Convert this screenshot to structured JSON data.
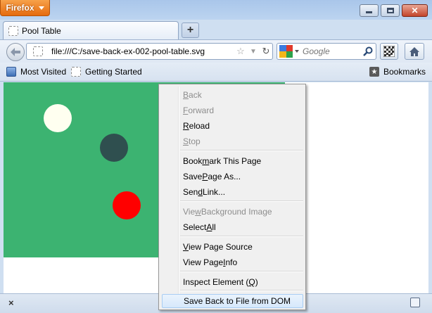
{
  "window": {
    "firefox_button": "Firefox",
    "tab_title": "Pool Table",
    "new_tab_label": "+",
    "close_glyph": "✕"
  },
  "navbar": {
    "url": "file:///C:/save-back-ex-002-pool-table.svg",
    "search_placeholder": "Google"
  },
  "bookmarks_bar": {
    "most_visited": "Most Visited",
    "getting_started": "Getting Started",
    "bookmarks": "Bookmarks"
  },
  "statusbar": {
    "close_glyph": "×"
  },
  "page": {
    "table_color": "#3cb371",
    "balls": [
      {
        "name": "cue-ball",
        "color": "#fffff0"
      },
      {
        "name": "dark-ball",
        "color": "#2f4f4f"
      },
      {
        "name": "red-ball",
        "color": "#ff0000"
      }
    ]
  },
  "context_menu": {
    "items": [
      {
        "pre": "",
        "key": "B",
        "post": "ack",
        "disabled": true
      },
      {
        "pre": "",
        "key": "F",
        "post": "orward",
        "disabled": true
      },
      {
        "pre": "",
        "key": "R",
        "post": "eload",
        "disabled": false
      },
      {
        "pre": "",
        "key": "S",
        "post": "top",
        "disabled": true
      },
      {
        "pre": "Book",
        "key": "m",
        "post": "ark This Page",
        "disabled": false
      },
      {
        "pre": "Save ",
        "key": "P",
        "post": "age As...",
        "disabled": false
      },
      {
        "pre": "Sen",
        "key": "d",
        "post": " Link...",
        "disabled": false
      },
      {
        "pre": "Vie",
        "key": "w",
        "post": " Background Image",
        "disabled": true
      },
      {
        "pre": "Select ",
        "key": "A",
        "post": "ll",
        "disabled": false
      },
      {
        "pre": "",
        "key": "V",
        "post": "iew Page Source",
        "disabled": false
      },
      {
        "pre": "View Page ",
        "key": "I",
        "post": "nfo",
        "disabled": false
      },
      {
        "pre": "Inspect Element (",
        "key": "Q",
        "post": ")",
        "disabled": false
      },
      {
        "pre": "Save Back to File from DOM",
        "key": "",
        "post": "",
        "disabled": false,
        "highlighted": true
      }
    ]
  }
}
